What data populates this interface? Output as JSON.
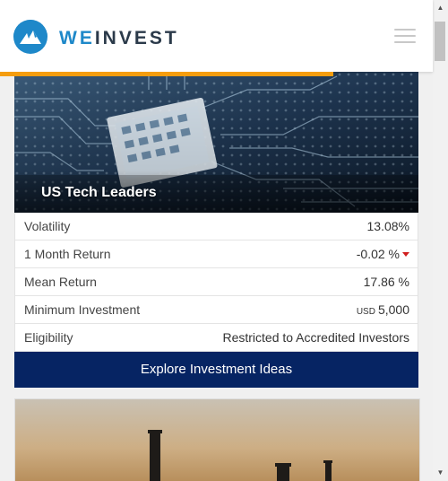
{
  "brand": {
    "name_part1": "WE",
    "name_part2": "INVEST",
    "logo_color": "#1e88c9"
  },
  "header": {
    "menu_icon": "hamburger-menu-icon",
    "progress_fraction": 0.77,
    "progress_color": "#f59d0e"
  },
  "card": {
    "title": "US Tech Leaders",
    "stats": [
      {
        "label": "Volatility",
        "value": "13.08%"
      },
      {
        "label": "1 Month Return",
        "value": "-0.02 %",
        "trend": "down"
      },
      {
        "label": "Mean Return",
        "value": "17.86 %"
      },
      {
        "label": "Minimum Investment",
        "currency": "USD",
        "value": "5,000"
      },
      {
        "label": "Eligibility",
        "value": "Restricted to Accredited Investors"
      }
    ],
    "button_label": "Explore Investment Ideas",
    "button_color": "#062463"
  }
}
